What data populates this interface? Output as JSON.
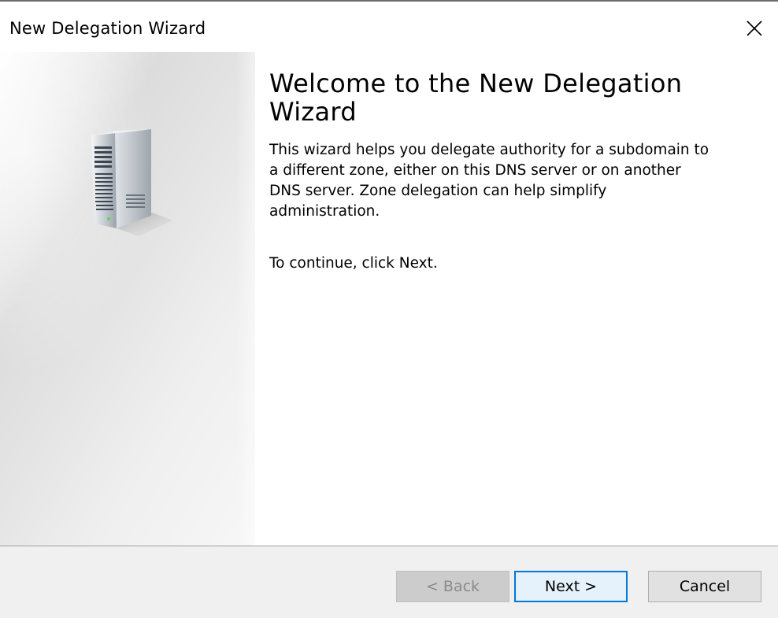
{
  "window": {
    "title": "New Delegation Wizard"
  },
  "icons": {
    "close": "close-icon",
    "server": "server-tower-icon"
  },
  "content": {
    "heading": "Welcome to the New Delegation Wizard",
    "description": "This wizard helps you delegate authority for a subdomain to a different zone, either on this DNS server or on another DNS server. Zone delegation can help simplify administration.",
    "instruction": "To continue, click Next."
  },
  "buttons": {
    "back": {
      "label": "< Back",
      "enabled": false
    },
    "next": {
      "label": "Next >",
      "enabled": true,
      "default": true
    },
    "cancel": {
      "label": "Cancel",
      "enabled": true
    }
  },
  "colors": {
    "focus_border": "#0078d7",
    "footer_bg": "#f0f0f0",
    "disabled_text": "#8a8a8a"
  }
}
